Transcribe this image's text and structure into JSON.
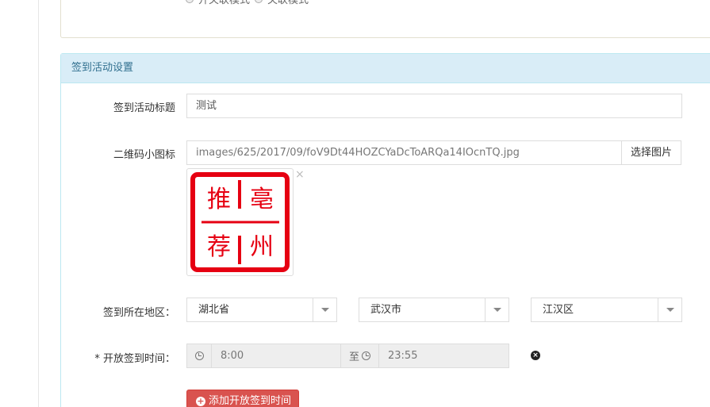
{
  "top_panel": {
    "mode_options": [
      "开关联模式",
      "关联模式"
    ]
  },
  "section": {
    "title": "签到活动设置"
  },
  "form": {
    "title_label": "签到活动标题",
    "title_value": "测试",
    "qrcode_label": "二维码小图标",
    "qrcode_path": "images/625/2017/09/foV9Dt44HOZCYaDcToARQa14IOcnTQ.jpg",
    "choose_image_label": "选择图片",
    "remove_image_symbol": "×",
    "seal": {
      "chars": [
        "推",
        "亳",
        "荐",
        "州"
      ],
      "color": "#e60012"
    },
    "region_label": "签到所在地区：",
    "province": "湖北省",
    "city": "武汉市",
    "district": "江汉区",
    "time_label": "* 开放签到时间：",
    "time_start": "8:00",
    "time_separator": "至",
    "time_end": "23:55",
    "remove_time_symbol": "×",
    "add_time_label": "添加开放签到时间",
    "add_symbol": "+"
  },
  "colors": {
    "panel_heading_bg": "#d9edf7",
    "panel_heading_text": "#31708f",
    "danger": "#d9534f"
  }
}
